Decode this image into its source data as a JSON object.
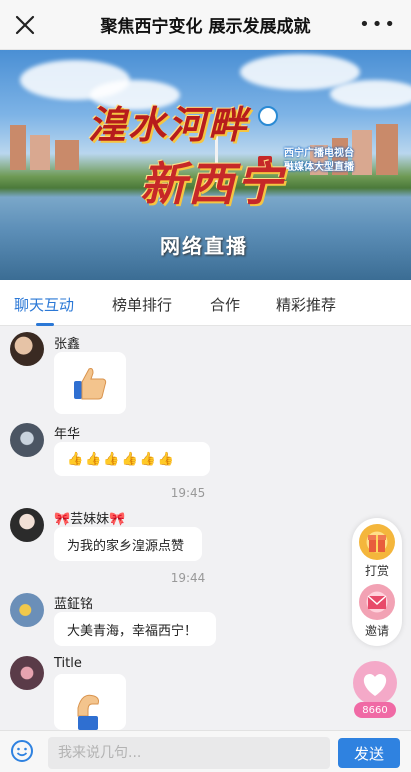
{
  "header": {
    "title": "聚焦西宁变化 展示发展成就",
    "close_icon": "close-icon",
    "more_icon": "more-icon",
    "more_glyph": "•••"
  },
  "banner": {
    "slogan_line1": "湟水河畔",
    "slogan_line2": "新西宁",
    "subtitle": "网络直播",
    "org_line1": "西宁广播电视台",
    "org_line2": "融媒体大型直播"
  },
  "tabs": [
    {
      "label": "聊天互动",
      "active": true
    },
    {
      "label": "榜单排行",
      "active": false
    },
    {
      "label": "合作",
      "active": false
    },
    {
      "label": "精彩推荐",
      "active": false
    }
  ],
  "messages": [
    {
      "user": "张鑫",
      "content_type": "sticker",
      "sticker": "thumbs-up-sticker"
    },
    {
      "user": "年华",
      "content_type": "emoji",
      "text": "👍👍👍👍👍👍"
    },
    {
      "timestamp": "19:45"
    },
    {
      "user": "🎀芸妹妹🎀",
      "content_type": "text",
      "text": "为我的家乡湟源点赞"
    },
    {
      "timestamp": "19:44"
    },
    {
      "user": "蓝鉦铭",
      "content_type": "text",
      "text": "大美青海，幸福西宁！"
    },
    {
      "user": "Title",
      "content_type": "sticker",
      "sticker": "flexed-arm-sticker"
    }
  ],
  "side_actions": [
    {
      "label": "打赏",
      "icon": "gift-icon"
    },
    {
      "label": "邀请",
      "icon": "invite-envelope-icon"
    }
  ],
  "like": {
    "count": "8660",
    "icon": "heart-like-icon"
  },
  "input": {
    "placeholder": "我来说几句...",
    "send_label": "发送",
    "emoji_icon": "emoji-icon"
  },
  "colors": {
    "accent": "#2b78d6",
    "send_button": "#2f82e0",
    "like_pink": "#f06aa5"
  }
}
